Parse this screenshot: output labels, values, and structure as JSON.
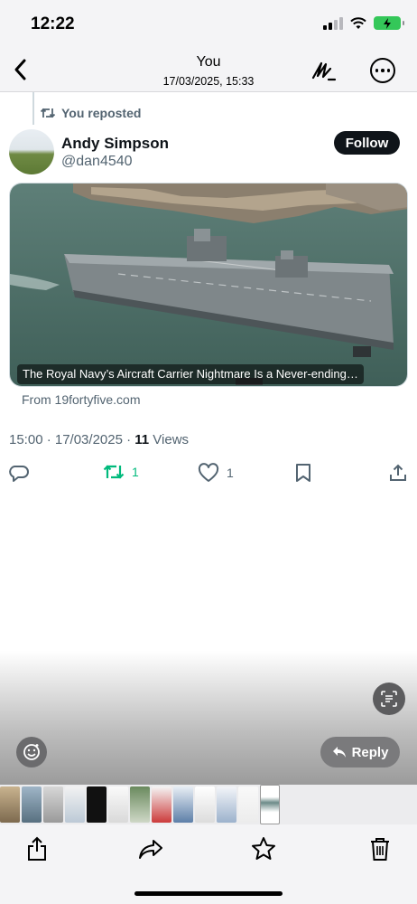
{
  "status_bar": {
    "time": "12:22"
  },
  "header": {
    "title": "You",
    "subtitle": "17/03/2025, 15:33"
  },
  "post": {
    "repost_label": "You reposted",
    "author_name": "Andy Simpson",
    "author_handle": "@dan4540",
    "follow_label": "Follow",
    "card_caption": "The Royal Navy’s Aircraft Carrier Nightmare Is a Never-ending…",
    "link_source": "From 19fortyfive.com",
    "timestamp": "15:00 · 17/03/2025 · ",
    "views_count": "11",
    "views_label": " Views",
    "repost_count": "1",
    "like_count": "1"
  },
  "viewer": {
    "reply_label": "Reply"
  },
  "colors": {
    "repost_green": "#00ba7c",
    "text_secondary": "#536471",
    "battery_green": "#34c759"
  },
  "icons": [
    "back-chevron-icon",
    "markup-pen-icon",
    "more-icon",
    "repost-icon",
    "reply-icon",
    "like-icon",
    "bookmark-icon",
    "share-icon",
    "live-text-icon",
    "visual-lookup-icon",
    "reply-arrow-icon",
    "export-icon",
    "forward-icon",
    "star-icon",
    "trash-icon"
  ]
}
